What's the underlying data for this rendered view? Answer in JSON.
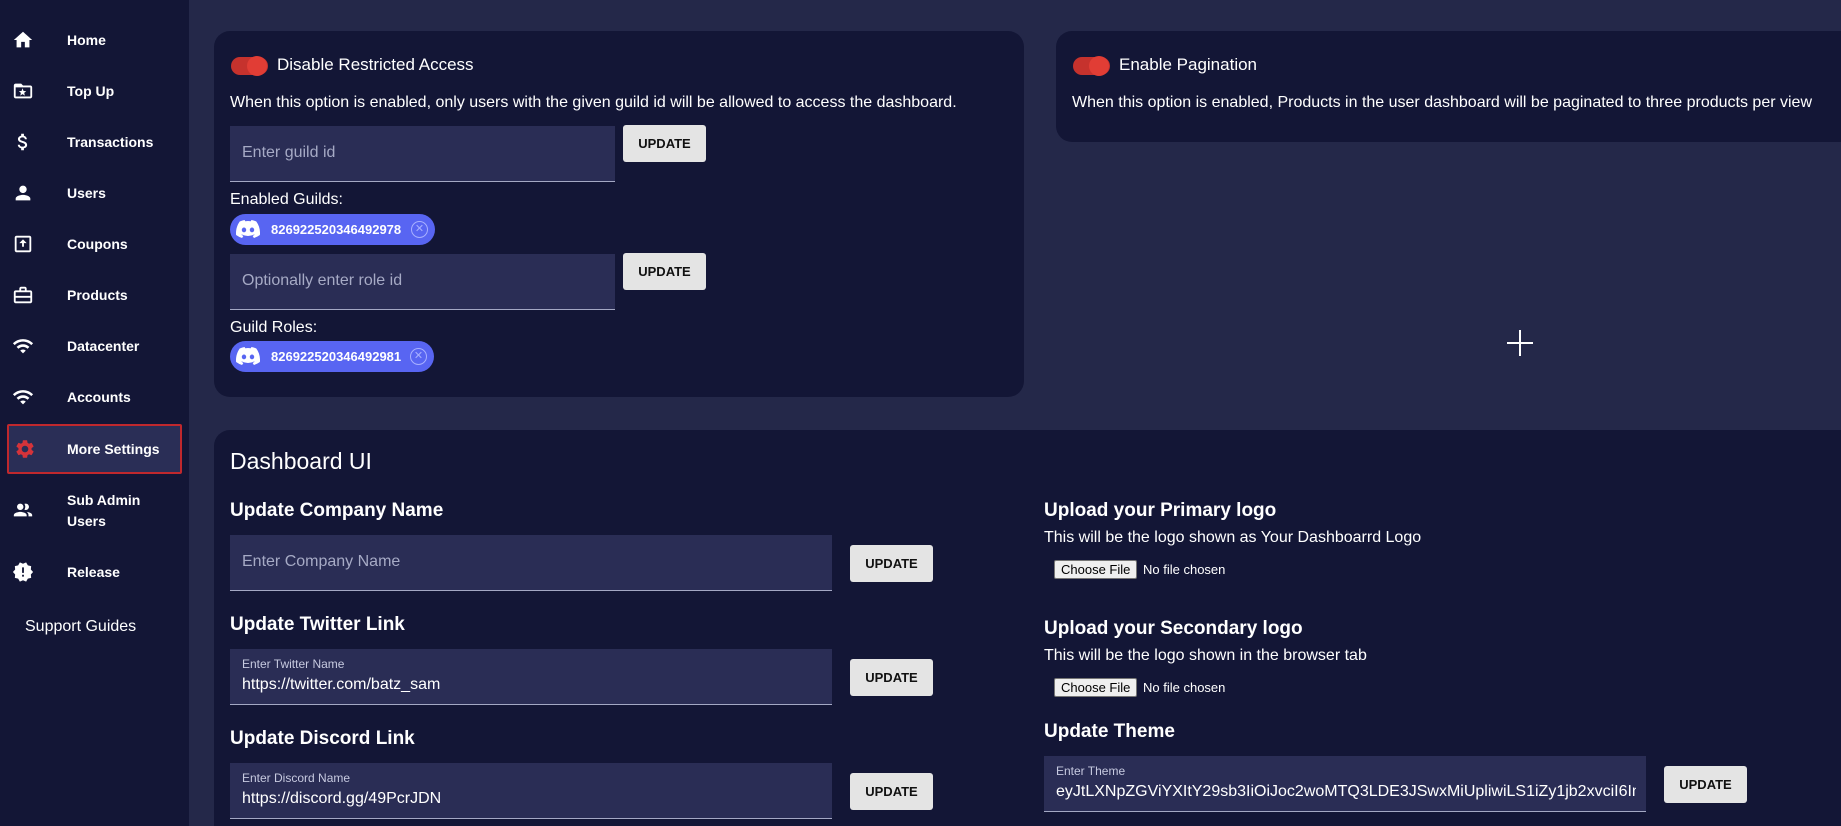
{
  "sidebar": {
    "items": [
      {
        "label": "Home",
        "icon": "home-icon"
      },
      {
        "label": "Top Up",
        "icon": "folder-star-icon"
      },
      {
        "label": "Transactions",
        "icon": "dollar-icon"
      },
      {
        "label": "Users",
        "icon": "user-icon"
      },
      {
        "label": "Coupons",
        "icon": "upload-box-icon"
      },
      {
        "label": "Products",
        "icon": "briefcase-icon"
      },
      {
        "label": "Datacenter",
        "icon": "wifi-icon"
      },
      {
        "label": "Accounts",
        "icon": "wifi-icon"
      },
      {
        "label": "More Settings",
        "icon": "gear-icon",
        "active": true
      },
      {
        "label": "Sub Admin Users",
        "icon": "users-icon"
      },
      {
        "label": "Release",
        "icon": "badge-alert-icon"
      }
    ],
    "support_guides": "Support Guides"
  },
  "restricted_access": {
    "toggle_label": "Disable Restricted Access",
    "toggle_on": true,
    "description": "When this option is enabled, only users with the given guild id will be allowed to access the dashboard.",
    "guild_input_placeholder": "Enter guild id",
    "guild_update": "UPDATE",
    "enabled_guilds_label": "Enabled Guilds:",
    "enabled_guild_chip": "826922520346492978",
    "role_input_placeholder": "Optionally enter role id",
    "role_update": "UPDATE",
    "guild_roles_label": "Guild Roles:",
    "guild_role_chip": "826922520346492981",
    "chip_close": "✕"
  },
  "pagination": {
    "toggle_label": "Enable Pagination",
    "toggle_on": true,
    "description": "When this option is enabled, Products in the user dashboard will be paginated to three products per view"
  },
  "dashboard_ui": {
    "title": "Dashboard UI",
    "company": {
      "heading": "Update Company Name",
      "placeholder": "Enter Company Name",
      "button": "UPDATE"
    },
    "twitter": {
      "heading": "Update Twitter Link",
      "field_label": "Enter Twitter Name",
      "value": "https://twitter.com/batz_sam",
      "button": "UPDATE"
    },
    "discord": {
      "heading": "Update Discord Link",
      "field_label": "Enter Discord Name",
      "value": "https://discord.gg/49PcrJDN",
      "button": "UPDATE"
    },
    "primary_logo": {
      "heading": "Upload your Primary logo",
      "description": "This will be the logo shown as Your Dashboarrd Logo",
      "choose_file": "Choose File",
      "status": "No file chosen"
    },
    "secondary_logo": {
      "heading": "Upload your Secondary logo",
      "description": "This will be the logo shown in the browser tab",
      "choose_file": "Choose File",
      "status": "No file chosen"
    },
    "theme": {
      "heading": "Update Theme",
      "field_label": "Enter Theme",
      "value": "eyJtLXNpZGViYXItY29sb3IiOiJoc2woMTQ3LDE3JSwxMiUpliwiLS1iZy1jb2xvciI6Im",
      "button": "UPDATE"
    }
  },
  "colors": {
    "page_bg": "#242849",
    "card_bg": "#131636",
    "accent_red": "#e13d35",
    "discord_blurple": "#5865f2",
    "input_bg": "#2a2d55"
  }
}
